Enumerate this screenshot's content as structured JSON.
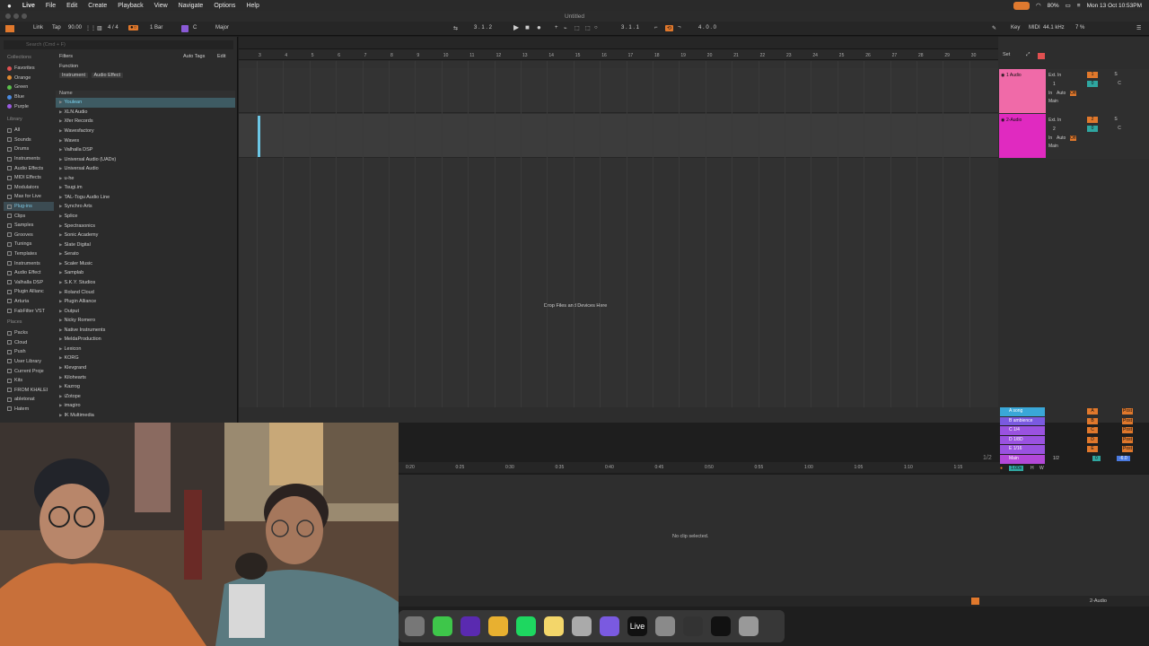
{
  "menubar": {
    "apple": "",
    "app": "Live",
    "items": [
      "File",
      "Edit",
      "Create",
      "Playback",
      "View",
      "Navigate",
      "Options",
      "Help"
    ],
    "battery": "80%",
    "datetime": "Mon 13 Oct  10:53PM"
  },
  "window": {
    "title": "Untitled"
  },
  "control": {
    "link": "Link",
    "tap": "Tap",
    "tempo": "90.00",
    "signature": "4 / 4",
    "quantize": "1 Bar",
    "key": "C",
    "scale": "Major",
    "position": "3 .  1 .  2",
    "loop_start": "3 .  1 .  1",
    "loop_length": "4 .  0 .  0",
    "key_label": "Key",
    "midi_label": "MIDI",
    "sample_rate": "44.1 kHz",
    "cpu": "7 %"
  },
  "browser": {
    "search_placeholder": "Search (Cmd + F)",
    "collections_head": "Collections",
    "collections": [
      {
        "label": "Favorites",
        "color": "#e05050"
      },
      {
        "label": "Orange",
        "color": "#e08a30"
      },
      {
        "label": "Green",
        "color": "#5bbf4a"
      },
      {
        "label": "Blue",
        "color": "#4a8ae0"
      },
      {
        "label": "Purple",
        "color": "#9a5ae0"
      }
    ],
    "library_head": "Library",
    "library": [
      "All",
      "Sounds",
      "Drums",
      "Instruments",
      "Audio Effects",
      "MIDI Effects",
      "Modulators",
      "Max for Live",
      "Plug-ins",
      "Clips",
      "Samples",
      "Grooves",
      "Tunings",
      "Templates",
      "Instruments",
      "Audio Effect",
      "Valhalla DSP",
      "Plugin Allianc",
      "Arturia",
      "FabFilter VST"
    ],
    "places_head": "Places",
    "places": [
      "Packs",
      "Cloud",
      "Push",
      "User Library",
      "Current Proje",
      "Kits",
      "FROM KHALEI",
      "abletonat",
      "Hatem"
    ],
    "filters_label": "Filters",
    "auto_tags": "Auto Tags",
    "edit": "Edit",
    "function": "Function",
    "chip_instrument": "Instrument",
    "chip_audio_effect": "Audio Effect",
    "name_head": "Name",
    "items": [
      "Youlean",
      "XLN Audio",
      "Xfer Records",
      "Wavesfactory",
      "Waves",
      "Valhalla DSP",
      "Universal Audio (UADx)",
      "Universal Audio",
      "u-he",
      "Tsugi.im",
      "TAL-Togu Audio Line",
      "Synchro Arts",
      "Splice",
      "Spectrasonics",
      "Sonic Academy",
      "Slate Digital",
      "Serato",
      "Scaler Music",
      "Samplab",
      "S.K.Y. Studios",
      "Roland Cloud",
      "Plugin Alliance",
      "Output",
      "Nicky Romero",
      "Native Instruments",
      "MeldaProduction",
      "Lexicon",
      "KORG",
      "Klevgrand",
      "Kilohearts",
      "Kazrog",
      "iZotope",
      "imagiro",
      "IK Multimedia"
    ]
  },
  "arrangement": {
    "bars": [
      "3",
      "4",
      "5",
      "6",
      "7",
      "8",
      "9",
      "10",
      "11",
      "12",
      "13",
      "14",
      "15",
      "16",
      "17",
      "18",
      "19",
      "20",
      "21",
      "22",
      "23",
      "24",
      "25",
      "26",
      "27",
      "28",
      "29",
      "30"
    ],
    "drop_text": "Drop Files and Devices Here",
    "set_label": "Set"
  },
  "tracks": [
    {
      "name": "1 Audio",
      "color": "#f06aa8",
      "input": "Ext. In",
      "channel": "1",
      "monitor_in": "In",
      "monitor_auto": "Auto",
      "monitor_off": "Off",
      "output": "Main",
      "number": "1",
      "vol": "0",
      "pan": "C",
      "solo": "S"
    },
    {
      "name": "2-Audio",
      "color": "#e02ac0",
      "input": "Ext. In",
      "channel": "2",
      "monitor_in": "In",
      "monitor_auto": "Auto",
      "monitor_off": "Off",
      "output": "Main",
      "number": "2",
      "vol": "0",
      "pan": "C",
      "solo": "S"
    }
  ],
  "returns": [
    {
      "name": "A song",
      "color": "#3aa7d8",
      "letter": "A"
    },
    {
      "name": "B ambience",
      "color": "#7a5ae0",
      "letter": "B"
    },
    {
      "name": "C 1/4",
      "color": "#9a52e0",
      "letter": "C"
    },
    {
      "name": "D 1/8D",
      "color": "#9a52e0",
      "letter": "D"
    },
    {
      "name": "E 1/16",
      "color": "#9a52e0",
      "letter": "E"
    },
    {
      "name": "Main",
      "color": "#b248d8",
      "letter": ""
    }
  ],
  "master": {
    "fraction": "1/2",
    "value": "0",
    "db": "-6.0",
    "post": "Post",
    "zoom": "1.00x",
    "h": "H",
    "w": "W"
  },
  "timeline": [
    "0:20",
    "0:25",
    "0:30",
    "0:35",
    "0:40",
    "0:45",
    "0:50",
    "0:55",
    "1:00",
    "1:05",
    "1:10",
    "1:15"
  ],
  "detail": {
    "no_clip": "No clip selected."
  },
  "status": {
    "track": "2-Audio"
  },
  "dock": [
    {
      "name": "launchpad-icon",
      "color": "#777"
    },
    {
      "name": "messages-icon",
      "color": "#3ec64a"
    },
    {
      "name": "app-icon",
      "color": "#5a2ab0"
    },
    {
      "name": "chrome-icon",
      "color": "#e8b030"
    },
    {
      "name": "spotify-icon",
      "color": "#1ed760"
    },
    {
      "name": "notes-icon",
      "color": "#f3d66a"
    },
    {
      "name": "music-icon",
      "color": "#aaa"
    },
    {
      "name": "logic-icon",
      "color": "#7a5ae0"
    },
    {
      "name": "live-icon",
      "color": "#111"
    },
    {
      "name": "settings-icon",
      "color": "#8a8a8a"
    },
    {
      "name": "piano-icon",
      "color": "#333"
    },
    {
      "name": "splice-icon",
      "color": "#111"
    },
    {
      "name": "trash-icon",
      "color": "#999"
    }
  ],
  "dock_labels": {
    "live": "Live"
  }
}
